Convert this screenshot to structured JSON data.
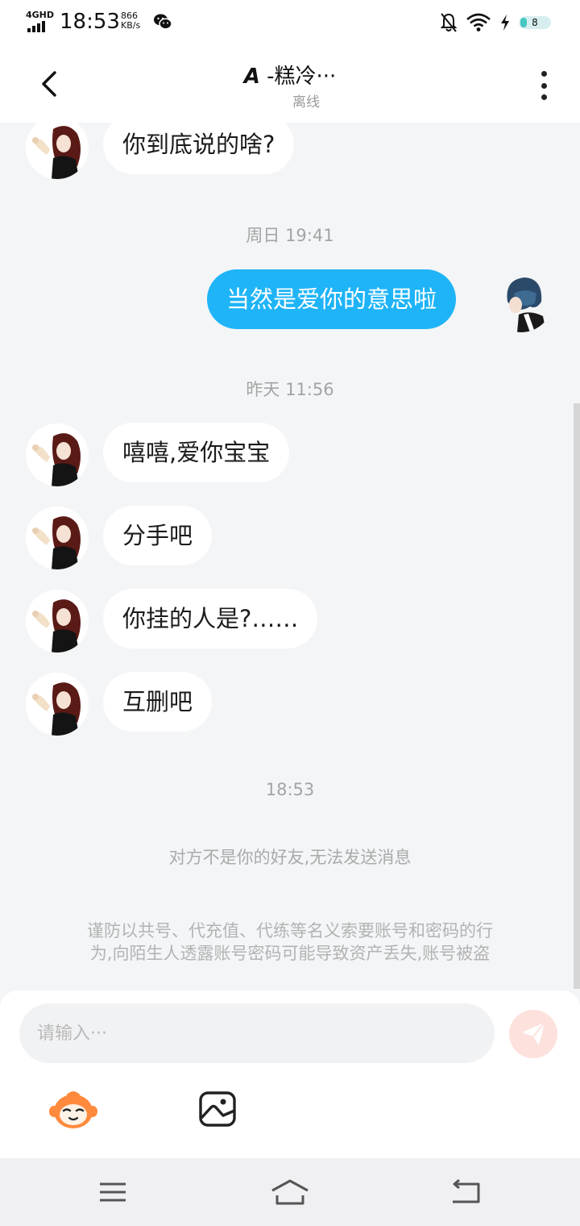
{
  "status_bar": {
    "network": "4GHD",
    "time": "18:53",
    "speed_value": "866",
    "speed_unit": "KB/s",
    "battery": "8",
    "icons": [
      "wechat-icon",
      "bell-off-icon",
      "wifi-icon",
      "charging-icon",
      "battery-icon"
    ]
  },
  "header": {
    "title": "𝘼 -糕冷···",
    "subtitle": "离线",
    "icons": [
      "back-arrow-icon",
      "more-vertical-icon"
    ]
  },
  "messages": [
    {
      "from": "them",
      "text": "你到底说的啥?"
    },
    {
      "type": "time",
      "text": "周日 19:41"
    },
    {
      "from": "me",
      "text": "当然是爱你的意思啦"
    },
    {
      "type": "time",
      "text": "昨天 11:56"
    },
    {
      "from": "them",
      "text": "嘻嘻,爱你宝宝"
    },
    {
      "from": "them",
      "text": "分手吧"
    },
    {
      "from": "them",
      "text": "你挂的人是?……"
    },
    {
      "from": "them",
      "text": "互删吧"
    },
    {
      "type": "time",
      "text": "18:53"
    }
  ],
  "notice": "对方不是你的好友,无法发送消息",
  "warning_lines": [
    "谨防以共号、代充值、代练等名义索要账号和密码的行",
    "为,向陌生人透露账号密码可能导致资产丢失,账号被盗"
  ],
  "input": {
    "placeholder": "请输入···",
    "value": ""
  },
  "toolbar": {
    "icons": [
      "send-icon",
      "emoji-mascot-icon",
      "image-icon"
    ]
  },
  "nav_bar": {
    "icons": [
      "menu-icon",
      "home-icon",
      "back-icon"
    ]
  },
  "colors": {
    "my_bubble": "#1fb4f7",
    "their_bubble": "#ffffff",
    "background": "#f3f5f7",
    "send_button": "#fde1dd"
  }
}
